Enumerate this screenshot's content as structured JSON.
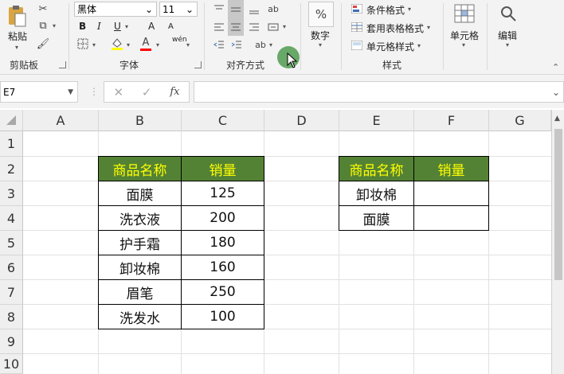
{
  "ribbon": {
    "clipboard": {
      "paste_label": "粘贴",
      "group_label": "剪贴板"
    },
    "font": {
      "name": "黑体",
      "size": "11",
      "bold": "B",
      "italic": "I",
      "underline": "U",
      "grow": "A",
      "shrink": "A",
      "font_color_glyph": "A",
      "phonetic_glyph": "wén",
      "group_label": "字体"
    },
    "alignment": {
      "group_label": "对齐方式"
    },
    "number": {
      "percent_glyph": "%",
      "label": "数字"
    },
    "styles": {
      "conditional": "条件格式",
      "table": "套用表格格式",
      "cell": "单元格样式",
      "group_label": "样式"
    },
    "cells": {
      "label": "单元格"
    },
    "editing": {
      "label": "编辑"
    }
  },
  "formula_bar": {
    "name_box": "E7",
    "fx": "fx",
    "formula": ""
  },
  "columns": [
    "A",
    "B",
    "C",
    "D",
    "E",
    "F",
    "G"
  ],
  "rows": [
    "1",
    "2",
    "3",
    "4",
    "5",
    "6",
    "7",
    "8",
    "9",
    "10"
  ],
  "table1": {
    "header": [
      "商品名称",
      "销量"
    ],
    "rows": [
      [
        "面膜",
        "125"
      ],
      [
        "洗衣液",
        "200"
      ],
      [
        "护手霜",
        "180"
      ],
      [
        "卸妆棉",
        "160"
      ],
      [
        "眉笔",
        "250"
      ],
      [
        "洗发水",
        "100"
      ]
    ]
  },
  "table2": {
    "header": [
      "商品名称",
      "销量"
    ],
    "rows": [
      [
        "卸妆棉",
        ""
      ],
      [
        "面膜",
        ""
      ]
    ]
  },
  "colors": {
    "header_fill": "#548235",
    "header_text": "#ffff00"
  }
}
